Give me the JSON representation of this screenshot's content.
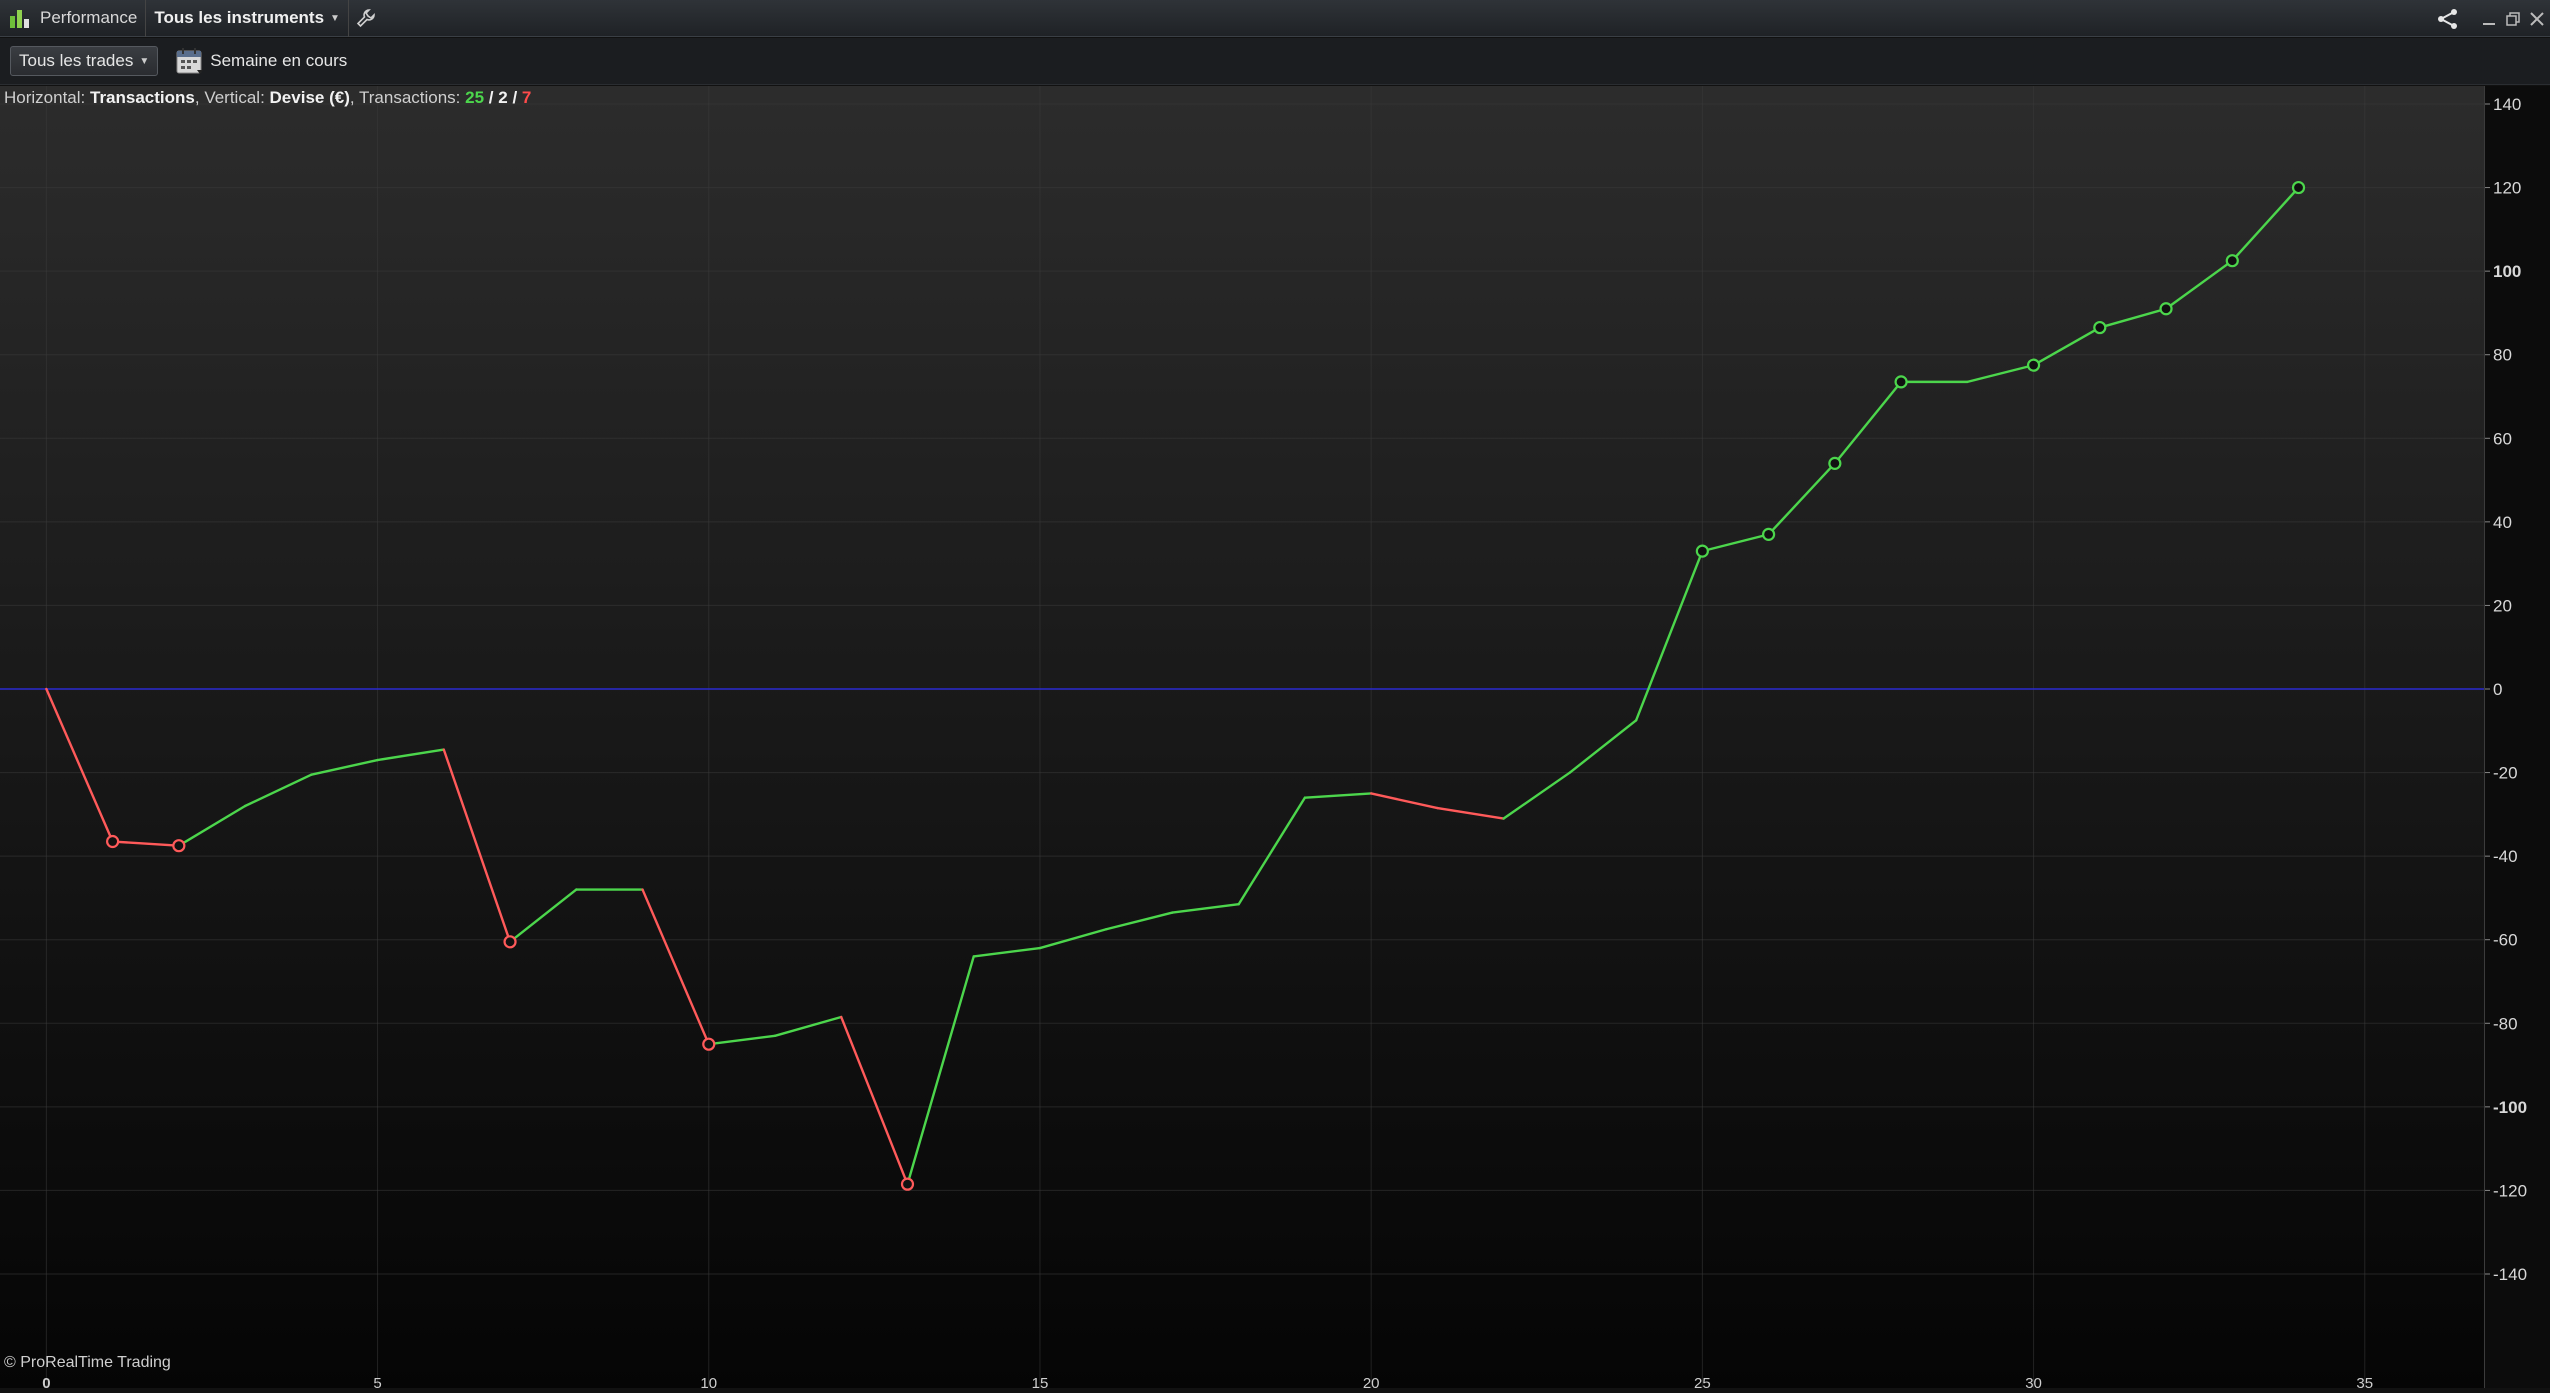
{
  "window": {
    "title": "Performance",
    "instrument_selector": "Tous les instruments"
  },
  "toolbar": {
    "trades_filter": "Tous les trades",
    "period": "Semaine en cours"
  },
  "info": {
    "horizontal_label": "Horizontal:",
    "horizontal_value": "Transactions",
    "vertical_label": ", Vertical:",
    "vertical_value": "Devise (€)",
    "transactions_label": ", Transactions:",
    "total": "25",
    "sep1": " / ",
    "mid": "2",
    "sep2": " / ",
    "losses": "7"
  },
  "copyright": "© ProRealTime Trading",
  "colors": {
    "gain": "#4cd64c",
    "loss": "#ff5a5a",
    "zero_line": "#2a2ad0",
    "background_top": "#2c2c2c",
    "background_bottom": "#050505"
  },
  "icons": [
    "performance-app-icon",
    "wrench-icon",
    "share-icon",
    "minimize-icon",
    "restore-icon",
    "close-icon",
    "calendar-icon"
  ],
  "chart_data": {
    "type": "line",
    "xlabel": "Transactions",
    "ylabel": "Devise (€)",
    "xlim": [
      -0.7,
      36.8
    ],
    "ylim": [
      -140,
      140
    ],
    "x_ticks": [
      0,
      5,
      10,
      15,
      20,
      25,
      30,
      35
    ],
    "y_ticks": [
      140,
      120,
      100,
      80,
      60,
      40,
      20,
      0,
      -20,
      -40,
      -60,
      -80,
      -100,
      -120,
      -140
    ],
    "y_ticks_bold": [
      100,
      -100
    ],
    "x_ticks_bold": [
      0
    ],
    "grid": true,
    "x": [
      0,
      1,
      2,
      3,
      4,
      5,
      6,
      7,
      8,
      9,
      10,
      11,
      12,
      13,
      14,
      15,
      16,
      17,
      18,
      19,
      20,
      21,
      22,
      23,
      24,
      25,
      26,
      27,
      28,
      29,
      30,
      31,
      32,
      33,
      34
    ],
    "y": [
      0,
      -36.5,
      -37.5,
      -28,
      -20.5,
      -17,
      -14.5,
      -60.5,
      -48,
      -48,
      -85,
      -83,
      -78.5,
      -118.5,
      -64,
      -62,
      -57.5,
      -53.5,
      -51.5,
      -26,
      -25,
      -28.5,
      -31,
      -20,
      -7.5,
      33,
      37,
      54,
      73.5,
      73.5,
      77.5,
      86.5,
      91,
      102.5,
      120
    ],
    "markers": [
      1,
      2,
      7,
      10,
      13,
      25,
      26,
      27,
      28,
      30,
      31,
      32,
      33,
      34
    ]
  }
}
